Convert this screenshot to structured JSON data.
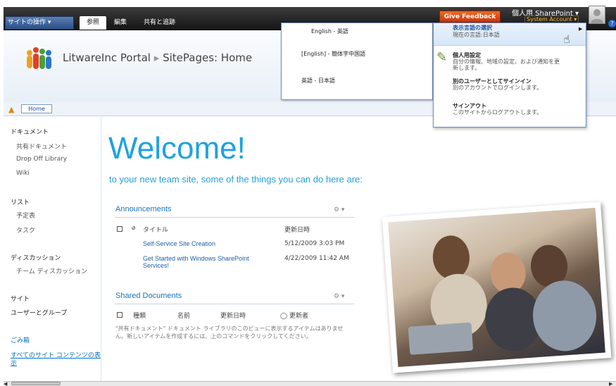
{
  "ribbon": {
    "site_actions": "サイトの操作 ▾",
    "tabs": [
      "参照",
      "編集",
      "共有と追跡"
    ],
    "give_feedback": "Give Feedback",
    "user_name": "個人用 SharePoint ▾",
    "account": "System Account ▾"
  },
  "site": {
    "portal": "LitwareInc Portal",
    "separator": "▸",
    "page": "SitePages: Home",
    "breadcrumb_home": "Home"
  },
  "nav": {
    "documents_head": "ドキュメント",
    "documents": [
      "共有ドキュメント",
      "Drop Off Library",
      "Wiki"
    ],
    "lists_head": "リスト",
    "lists": [
      "予定表",
      "タスク"
    ],
    "discussions_head": "ディスカッション",
    "discussions": [
      "チーム ディスカッション"
    ],
    "sites_head": "サイト",
    "people_groups": "ユーザーとグループ",
    "recycle_bin": "ごみ箱",
    "all_content_line1": "すべてのサイト コンテンツの表",
    "all_content_line2": "示"
  },
  "main": {
    "welcome": "Welcome!",
    "tagline": "to your new team site, some of the things you can do here are:"
  },
  "announcements": {
    "title": "Announcements",
    "gear": "⚙ ▾",
    "col_title": "タイトル",
    "col_modified": "更新日時",
    "rows": [
      {
        "title": "Self-Service Site Creation",
        "modified": "5/12/2009 3:03 PM"
      },
      {
        "title_line1": "Get Started with Windows SharePoint",
        "title_line2": "Services!",
        "modified": "4/22/2009 11:42 AM"
      }
    ]
  },
  "shared_docs": {
    "title": "Shared Documents",
    "gear": "⚙ ▾",
    "col_type": "種類",
    "col_name": "名前",
    "col_modified": "更新日時",
    "col_modifier": "更新者",
    "empty_message": "\"共有ドキュメント\" ドキュメント ライブラリのこのビューに表示するアイテムはありません。新しいアイテムを作成するには、上のコマンドをクリックしてください。"
  },
  "language_menu": {
    "options": [
      "English - 英語",
      "[English] - 簡体字中国語",
      "英語 - 日本語"
    ]
  },
  "user_menu": {
    "items": [
      {
        "title": "表示言語の選択",
        "desc": "現在の言語:日本語"
      },
      {
        "title": "個人用設定",
        "desc_line1": "自分の情報、地域の設定、および通知を更",
        "desc_line2": "新します。"
      },
      {
        "title": "別のユーザーとしてサインイン",
        "desc": "別のアカウントでログインします。"
      },
      {
        "title": "サインアウト",
        "desc": "このサイトからログアウトします。"
      }
    ]
  },
  "icons": {
    "help": "?",
    "up": "▲",
    "hand": "☝",
    "tools": "✎"
  }
}
